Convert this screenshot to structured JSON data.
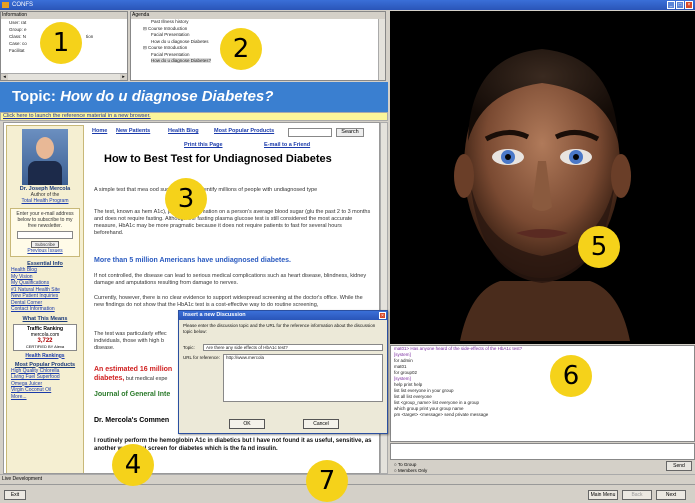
{
  "window": {
    "title": "CONFS"
  },
  "info_pane": {
    "header": "Information",
    "items": [
      "User: rat",
      "Group: e",
      "Class: N",
      "Case: co",
      "Facilitat"
    ],
    "items_right": [
      "",
      "",
      "tion",
      "",
      ""
    ]
  },
  "agenda_pane": {
    "header": "Agenda",
    "items": [
      {
        "indent": 1,
        "text": "Past Illness history"
      },
      {
        "indent": 0,
        "text": "Course Introduction"
      },
      {
        "indent": 1,
        "text": "Facial Presentation"
      },
      {
        "indent": 1,
        "text": "How do u diagnose Diabetes"
      },
      {
        "indent": 0,
        "text": "Course Introduction"
      },
      {
        "indent": 1,
        "text": "Facial Presentation"
      },
      {
        "indent": 1,
        "text": "How do u diagnose Diabetes?"
      }
    ]
  },
  "badges": [
    "1",
    "2",
    "3",
    "4",
    "5",
    "6",
    "7"
  ],
  "topic": {
    "prefix": "Topic:",
    "title": "How do u diagnose Diabetes?"
  },
  "launch_link": "Click here to launch the reference material in a new browser.",
  "article": {
    "nav": [
      "Home",
      "New Patients",
      "Health Blog",
      "Most Popular Products"
    ],
    "search_button": "Search",
    "print_link": "Print this Page",
    "email_link": "E-mail to a Friend",
    "title": "How to Best Test for Undiagnosed Diabetes",
    "p1": "A simple test that mea                  ood sugar may help identify millions of people with undiagnosed type",
    "p2": "The test, known as hem             A1c), provides information on a person's average blood sugar (glu                    the past 2 to 3 months and does not require fasting. Although the fasting plasma glucose test is still considered the most accurate measure, HbA1c may be more pragmatic because it does not require patients to fast for several hours beforehand.",
    "h_blue": "More than 5 million Americans have undiagnosed diabetes.",
    "p3": "If not controlled, the disease can lead to serious medical complications such as heart disease, blindness, kidney damage and amputations resulting from damage to nerves.",
    "p4": "Currently, however, there is no clear evidence to support widespread screening at the doctor's office. While the new findings do not show that the HbA1c test is a cost-effective way to do routine screening,",
    "p5": "The test was particularly effec individuals, those with high b disease.",
    "h_red_1": "An estimated 16 million",
    "h_red_2": "diabetes,",
    "h_red_2_rest": " but medical expe",
    "h_green": "Journal of General Inte",
    "h_black": "Dr. Mercola's Commen",
    "p_bold": "I routinely perform the hemoglobin A1c in diabetics but I have not found it as useful,           sensitive, as another wonderful screen for diabetes which is the fa                nd insulin."
  },
  "sidebar": {
    "name": "Dr. Joseph Mercola",
    "role": "Author of the",
    "program_link": "Total Health Program",
    "newsletter_text": "Enter your e-mail address below to subscribe to my free newsletter.",
    "subscribe": "Subscribe",
    "previous": "Previous Issues",
    "essential_head": "Essential Info",
    "essential_links": [
      "Health Blog",
      "My Vision",
      "My Qualifications",
      "#1 Natural Health Site",
      "New Patient Inquiries",
      "Dental Corner",
      "Contact Information"
    ],
    "means_head": "What This Means",
    "traffic_title": "Traffic Ranking",
    "traffic_site": "mercola.com",
    "traffic_num": "3,722",
    "alexa": "CERTIFIED BY Alexa",
    "rankings": "Health Rankings",
    "products_head": "Most Popular Products",
    "product_links": [
      "High Quality Chlorella",
      "Living Fuel Superfood",
      "Omega Juicer",
      "Virgin Coconut Oil",
      "More..."
    ]
  },
  "dialog": {
    "title": "Insert a new Discussion",
    "prompt": "Please enter the discussion topic and the URL for the reference information about the discussion topic below:",
    "topic_label": "Topic:",
    "topic_value": "Are there any side effects of HbA1c test?",
    "url_label": "URL for reference:",
    "url_value": "http://www.mercola",
    "ok": "OK",
    "cancel": "Cancel"
  },
  "chat": {
    "lines": [
      {
        "cls": "purple",
        "text": "mat01> Has anyone heard of the side-effects of the HbA1c test?"
      },
      {
        "cls": "sys",
        "text": "[system]"
      },
      {
        "cls": "",
        "text": "          for admin"
      },
      {
        "cls": "",
        "text": "          mat01"
      },
      {
        "cls": "",
        "text": "          for group02"
      },
      {
        "cls": "sys",
        "text": "[system]"
      },
      {
        "cls": "",
        "text": "  help   print help"
      },
      {
        "cls": "",
        "text": "  list   list everyone in your group"
      },
      {
        "cls": "",
        "text": "  list all   list everyone"
      },
      {
        "cls": "",
        "text": "  list <group_name>   list everyone in a group"
      },
      {
        "cls": "",
        "text": "  which group   print your group name"
      },
      {
        "cls": "",
        "text": "  pm <target> <message>   send private message"
      }
    ],
    "to_group": "To Group",
    "members_only": "Members Only",
    "send": "Send"
  },
  "status": {
    "live_dev": "Live Development"
  },
  "bottom": {
    "exit": "Exit",
    "main_menu": "Main Menu",
    "back": "Back",
    "next": "Next"
  },
  "colors": {
    "topic_bar": "#3a7fd0",
    "badge": "#f5d21a",
    "title_bar": "#2a55b8"
  }
}
